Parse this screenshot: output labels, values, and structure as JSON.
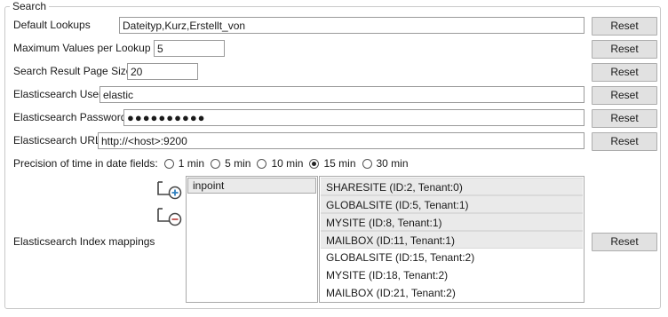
{
  "group": {
    "title": "Search"
  },
  "fields": {
    "default_lookups": {
      "label": "Default Lookups",
      "value": "Dateityp,Kurz,Erstellt_von"
    },
    "max_values": {
      "label": "Maximum Values per Lookup",
      "value": "5"
    },
    "page_size": {
      "label": "Search Result Page Size",
      "value": "20"
    },
    "es_user": {
      "label": "Elasticsearch User",
      "value": "elastic"
    },
    "es_password": {
      "label": "Elasticsearch Password",
      "value": "●●●●●●●●●●"
    },
    "es_url": {
      "label": "Elasticsearch URL",
      "value": "http://<host>:9200"
    }
  },
  "reset_label": "Reset",
  "precision": {
    "label": "Precision of time in date fields:",
    "options": [
      "1 min",
      "5 min",
      "10 min",
      "15 min",
      "30 min"
    ],
    "selected": "15 min"
  },
  "index_mappings": {
    "label": "Elasticsearch Index mappings",
    "add_icon": "add-mapping-icon",
    "remove_icon": "remove-mapping-icon",
    "indices": [
      "inpoint"
    ],
    "sites": [
      {
        "label": "SHARESITE (ID:2, Tenant:0)",
        "selected": true
      },
      {
        "label": "GLOBALSITE (ID:5, Tenant:1)",
        "selected": true
      },
      {
        "label": "MYSITE (ID:8, Tenant:1)",
        "selected": true
      },
      {
        "label": "MAILBOX (ID:11, Tenant:1)",
        "selected": true
      },
      {
        "label": "GLOBALSITE (ID:15, Tenant:2)",
        "selected": false
      },
      {
        "label": "MYSITE (ID:18, Tenant:2)",
        "selected": false
      },
      {
        "label": "MAILBOX (ID:21, Tenant:2)",
        "selected": false
      }
    ]
  },
  "colors": {
    "button_bg": "#e1e1e1",
    "selected_item_bg": "#eaeaea",
    "icon_green": "#6aa84f",
    "icon_red": "#c0504d"
  }
}
